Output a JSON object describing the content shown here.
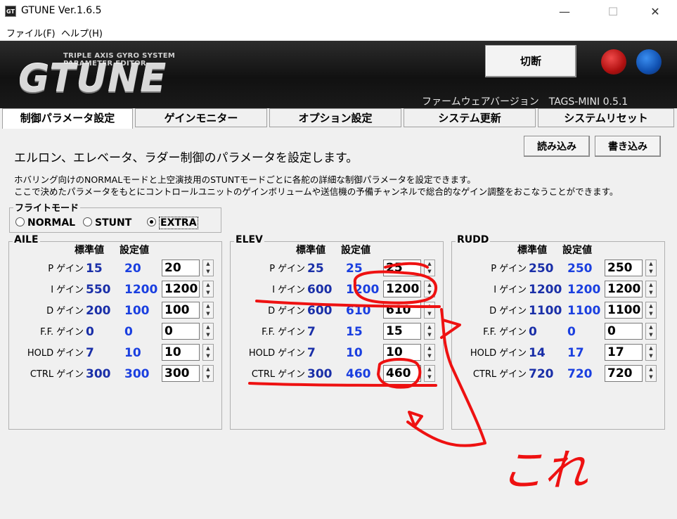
{
  "window": {
    "title": "GTUNE Ver.1.6.5",
    "app_icon": "GT",
    "minimize": "—",
    "maximize": "☐",
    "close": "✕"
  },
  "menu": [
    {
      "label": "ファイル(F)"
    },
    {
      "label": "ヘルプ(H)"
    }
  ],
  "header": {
    "logo_sub1": "TRIPLE AXIS GYRO SYSTEM",
    "logo_sub2": "PARAMETER EDITOR",
    "logo": "GTUNE",
    "disconnect": "切断",
    "firmware": "ファームウェアバージョン　TAGS-MINI  0.5.1"
  },
  "tabs": [
    {
      "label": "制御パラメータ設定",
      "active": true
    },
    {
      "label": "ゲインモニター"
    },
    {
      "label": "オプション設定"
    },
    {
      "label": "システム更新"
    },
    {
      "label": "システムリセット"
    }
  ],
  "content": {
    "heading": "エルロン、エレベータ、ラダー制御のパラメータを設定します。",
    "desc1": "ホバリング向けのNORMALモードと上空演技用のSTUNTモードごとに各舵の詳細な制御パラメータを設定できます。",
    "desc2": "ここで決めたパラメータをもとにコントロールユニットのゲインボリュームや送信機の予備チャンネルで総合的なゲイン調整をおこなうことができます。",
    "load": "読み込み",
    "write": "書き込み"
  },
  "flight_mode": {
    "label": "フライトモード",
    "options": [
      "NORMAL",
      "STUNT",
      "EXTRA"
    ],
    "selected": "EXTRA"
  },
  "columns": {
    "std": "標準値",
    "set": "設定値"
  },
  "param_labels": [
    "P ゲイン",
    "I ゲイン",
    "D ゲイン",
    "F.F. ゲイン",
    "HOLD ゲイン",
    "CTRL ゲイン"
  ],
  "groups": [
    {
      "name": "AILE",
      "rows": [
        {
          "std": "15",
          "set": "20",
          "input": "20"
        },
        {
          "std": "550",
          "set": "1200",
          "input": "1200"
        },
        {
          "std": "200",
          "set": "100",
          "input": "100"
        },
        {
          "std": "0",
          "set": "0",
          "input": "0"
        },
        {
          "std": "7",
          "set": "10",
          "input": "10"
        },
        {
          "std": "300",
          "set": "300",
          "input": "300"
        }
      ]
    },
    {
      "name": "ELEV",
      "rows": [
        {
          "std": "25",
          "set": "25",
          "input": "25"
        },
        {
          "std": "600",
          "set": "1200",
          "input": "1200"
        },
        {
          "std": "600",
          "set": "610",
          "input": "610"
        },
        {
          "std": "7",
          "set": "15",
          "input": "15"
        },
        {
          "std": "7",
          "set": "10",
          "input": "10"
        },
        {
          "std": "300",
          "set": "460",
          "input": "460"
        }
      ]
    },
    {
      "name": "RUDD",
      "rows": [
        {
          "std": "250",
          "set": "250",
          "input": "250"
        },
        {
          "std": "1200",
          "set": "1200",
          "input": "1200"
        },
        {
          "std": "1100",
          "set": "1100",
          "input": "1100"
        },
        {
          "std": "0",
          "set": "0",
          "input": "0"
        },
        {
          "std": "14",
          "set": "17",
          "input": "17"
        },
        {
          "std": "720",
          "set": "720",
          "input": "720"
        }
      ]
    }
  ],
  "annotation": {
    "text": "これ",
    "color": "#ff0000"
  }
}
